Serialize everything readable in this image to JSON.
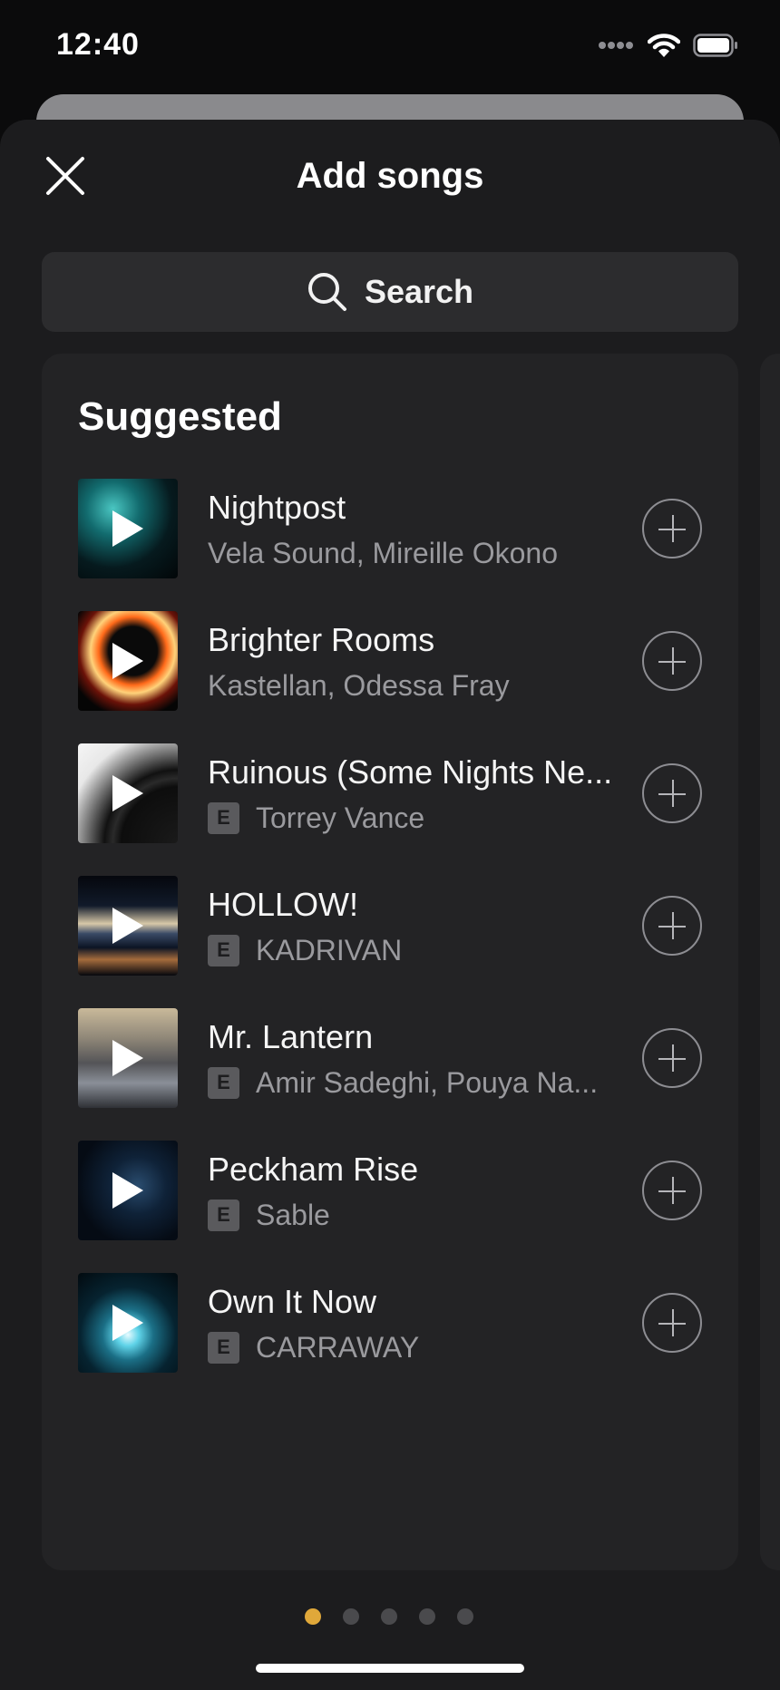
{
  "status": {
    "time": "12:40"
  },
  "header": {
    "title": "Add songs",
    "close_icon": "close-icon"
  },
  "search": {
    "label": "Search",
    "icon": "search-icon"
  },
  "suggested": {
    "title": "Suggested",
    "songs": [
      {
        "title": "Nightpost",
        "artists": "Vela Sound, Mireille Okono",
        "explicit": false,
        "explicit_label": ""
      },
      {
        "title": "Brighter Rooms",
        "artists": "Kastellan, Odessa Fray",
        "explicit": false,
        "explicit_label": ""
      },
      {
        "title": "Ruinous (Some Nights Ne...",
        "artists": "Torrey Vance",
        "explicit": true,
        "explicit_label": "E"
      },
      {
        "title": "HOLLOW!",
        "artists": "KADRIVAN",
        "explicit": true,
        "explicit_label": "E"
      },
      {
        "title": "Mr. Lantern",
        "artists": "Amir Sadeghi, Pouya Na...",
        "explicit": true,
        "explicit_label": "E"
      },
      {
        "title": "Peckham Rise",
        "artists": "Sable",
        "explicit": true,
        "explicit_label": "E"
      },
      {
        "title": "Own It Now",
        "artists": "CARRAWAY",
        "explicit": true,
        "explicit_label": "E"
      }
    ]
  },
  "pager": {
    "count": 5,
    "active_index": 0,
    "active_color": "#e0a83a",
    "inactive_color": "#4a4a4d"
  },
  "colors": {
    "background": "#0b0b0c",
    "sheet": "#1c1c1e",
    "panel": "#232325",
    "search_field": "#2c2c2e",
    "secondary_text": "#9a9a9e"
  }
}
